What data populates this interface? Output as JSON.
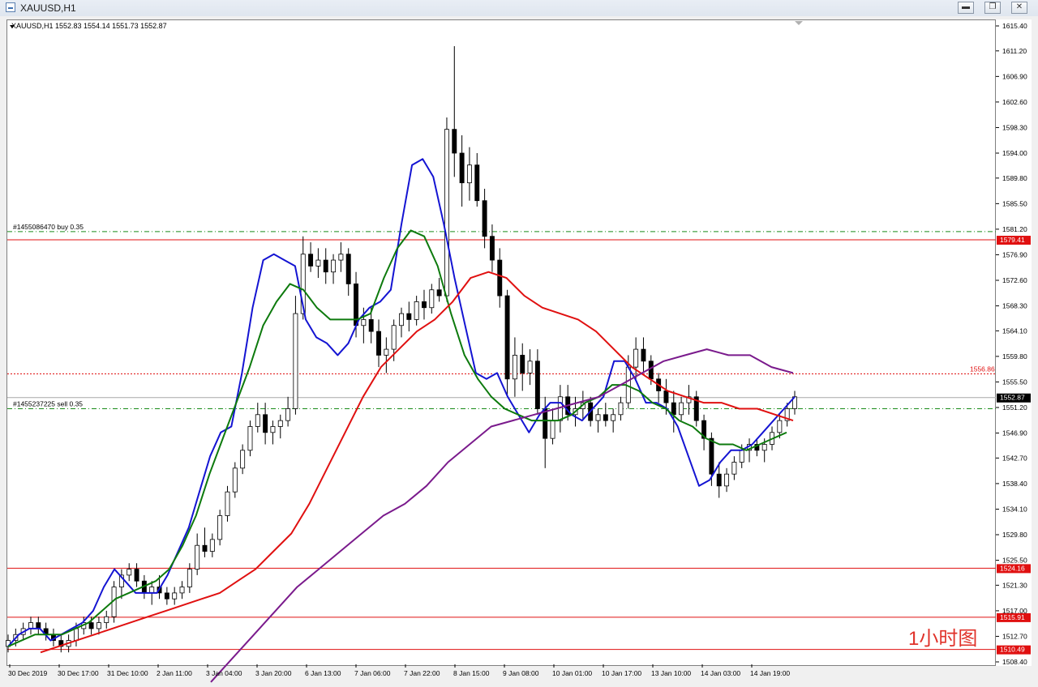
{
  "window": {
    "title": "XAUUSD,H1",
    "minimize_icon": "minimize-icon",
    "restore_icon": "restore-icon",
    "close_icon": "close-icon"
  },
  "header": {
    "symbol_info": "XAUUSD,H1  1552.83 1554.14 1551.73 1552.87",
    "dropdown_icon": "triangle-down-icon"
  },
  "annotation": {
    "text": "1小时图",
    "color": "#e0322a"
  },
  "colors": {
    "candle": "#000000",
    "ma_fast": "#1414d2",
    "ma_mid": "#0d7a0d",
    "ma_slow": "#e01010",
    "ma_long": "#7a1a8c",
    "level_line": "#e01010",
    "order_line": "#1a8c1a"
  },
  "chart_data": {
    "type": "line",
    "title": "",
    "xlabel": "",
    "ylabel": "",
    "ylim": [
      1508.4,
      1615.4
    ],
    "x_ticks": [
      "30 Dec 2019",
      "30 Dec 17:00",
      "31 Dec 10:00",
      "2 Jan 11:00",
      "3 Jan 04:00",
      "3 Jan 20:00",
      "6 Jan 13:00",
      "7 Jan 06:00",
      "7 Jan 22:00",
      "8 Jan 15:00",
      "9 Jan 08:00",
      "10 Jan 01:00",
      "10 Jan 17:00",
      "13 Jan 10:00",
      "14 Jan 03:00",
      "14 Jan 19:00"
    ],
    "y_ticks": [
      "1615.40",
      "1611.20",
      "1606.90",
      "1602.60",
      "1598.30",
      "1594.00",
      "1589.80",
      "1585.50",
      "1581.20",
      "1576.90",
      "1572.60",
      "1568.30",
      "1564.10",
      "1559.80",
      "1555.50",
      "1551.20",
      "1546.90",
      "1542.70",
      "1538.40",
      "1534.10",
      "1529.80",
      "1525.50",
      "1521.30",
      "1517.00",
      "1512.70",
      "1508.40"
    ],
    "last_price": "1552.87",
    "price_tags": [
      {
        "value": 1579.41,
        "label": "1579.41"
      },
      {
        "value": 1524.16,
        "label": "1524.16"
      },
      {
        "value": 1515.91,
        "label": "1515.91"
      },
      {
        "value": 1510.49,
        "label": "1510.49"
      }
    ],
    "alert_level": {
      "value": 1556.86,
      "label": "1556.86"
    },
    "orders": [
      {
        "label": "#1455086470 buy 0.35",
        "value": 1580.8
      },
      {
        "label": "#1455237225 sell 0.35",
        "value": 1551.0
      }
    ],
    "candles": [
      [
        1511,
        1513,
        1510,
        1512
      ],
      [
        1512,
        1514,
        1511,
        1513
      ],
      [
        1513,
        1515,
        1512,
        1514
      ],
      [
        1514,
        1516,
        1513,
        1515
      ],
      [
        1515,
        1516,
        1513,
        1514
      ],
      [
        1514,
        1515,
        1512,
        1513
      ],
      [
        1513,
        1514,
        1511,
        1512
      ],
      [
        1512,
        1513,
        1510,
        1511
      ],
      [
        1511,
        1513,
        1510,
        1512
      ],
      [
        1512,
        1515,
        1511,
        1514
      ],
      [
        1514,
        1516,
        1513,
        1515
      ],
      [
        1515,
        1516,
        1513,
        1514
      ],
      [
        1514,
        1516,
        1513,
        1515
      ],
      [
        1515,
        1517,
        1514,
        1516
      ],
      [
        1516,
        1522,
        1515,
        1521
      ],
      [
        1521,
        1524,
        1519,
        1523
      ],
      [
        1523,
        1525,
        1522,
        1524
      ],
      [
        1524,
        1525,
        1521,
        1522
      ],
      [
        1522,
        1523,
        1519,
        1520
      ],
      [
        1520,
        1522,
        1518,
        1521
      ],
      [
        1521,
        1523,
        1519,
        1520
      ],
      [
        1520,
        1521,
        1518,
        1519
      ],
      [
        1519,
        1521,
        1518,
        1520
      ],
      [
        1520,
        1522,
        1519,
        1521
      ],
      [
        1521,
        1525,
        1520,
        1524
      ],
      [
        1524,
        1530,
        1523,
        1528
      ],
      [
        1528,
        1531,
        1526,
        1527
      ],
      [
        1527,
        1530,
        1526,
        1529
      ],
      [
        1529,
        1534,
        1528,
        1533
      ],
      [
        1533,
        1538,
        1532,
        1537
      ],
      [
        1537,
        1542,
        1536,
        1541
      ],
      [
        1541,
        1545,
        1540,
        1544
      ],
      [
        1544,
        1549,
        1543,
        1548
      ],
      [
        1548,
        1552,
        1547,
        1550
      ],
      [
        1550,
        1552,
        1545,
        1547
      ],
      [
        1547,
        1549,
        1545,
        1548
      ],
      [
        1548,
        1550,
        1546,
        1549
      ],
      [
        1549,
        1553,
        1548,
        1551
      ],
      [
        1551,
        1570,
        1550,
        1567
      ],
      [
        1567,
        1580,
        1566,
        1577
      ],
      [
        1577,
        1579,
        1574,
        1575
      ],
      [
        1575,
        1578,
        1573,
        1576
      ],
      [
        1576,
        1578,
        1572,
        1574
      ],
      [
        1574,
        1577,
        1572,
        1576
      ],
      [
        1576,
        1579,
        1574,
        1577
      ],
      [
        1577,
        1578,
        1570,
        1572
      ],
      [
        1572,
        1574,
        1563,
        1565
      ],
      [
        1565,
        1568,
        1562,
        1566
      ],
      [
        1566,
        1568,
        1562,
        1564
      ],
      [
        1564,
        1566,
        1558,
        1560
      ],
      [
        1560,
        1563,
        1557,
        1561
      ],
      [
        1561,
        1566,
        1559,
        1565
      ],
      [
        1565,
        1568,
        1563,
        1567
      ],
      [
        1567,
        1569,
        1564,
        1566
      ],
      [
        1566,
        1570,
        1565,
        1569
      ],
      [
        1569,
        1571,
        1566,
        1568
      ],
      [
        1568,
        1572,
        1567,
        1571
      ],
      [
        1571,
        1573,
        1569,
        1570
      ],
      [
        1570,
        1600,
        1569,
        1598
      ],
      [
        1598,
        1612,
        1590,
        1594
      ],
      [
        1594,
        1597,
        1585,
        1589
      ],
      [
        1589,
        1595,
        1586,
        1592
      ],
      [
        1592,
        1594,
        1585,
        1586
      ],
      [
        1586,
        1588,
        1578,
        1580
      ],
      [
        1580,
        1582,
        1574,
        1576
      ],
      [
        1576,
        1578,
        1568,
        1570
      ],
      [
        1570,
        1571,
        1553,
        1556
      ],
      [
        1556,
        1563,
        1553,
        1560
      ],
      [
        1560,
        1562,
        1554,
        1557
      ],
      [
        1557,
        1561,
        1555,
        1559
      ],
      [
        1559,
        1561,
        1550,
        1551
      ],
      [
        1551,
        1553,
        1541,
        1546
      ],
      [
        1546,
        1551,
        1545,
        1549
      ],
      [
        1549,
        1555,
        1547,
        1553
      ],
      [
        1553,
        1555,
        1549,
        1550
      ],
      [
        1550,
        1553,
        1548,
        1551
      ],
      [
        1551,
        1554,
        1549,
        1552
      ],
      [
        1552,
        1553,
        1548,
        1549
      ],
      [
        1549,
        1551,
        1547,
        1550
      ],
      [
        1550,
        1552,
        1548,
        1549
      ],
      [
        1549,
        1551,
        1547,
        1550
      ],
      [
        1550,
        1553,
        1549,
        1552
      ],
      [
        1552,
        1560,
        1551,
        1558
      ],
      [
        1558,
        1563,
        1556,
        1561
      ],
      [
        1561,
        1563,
        1557,
        1559
      ],
      [
        1559,
        1560,
        1555,
        1556
      ],
      [
        1556,
        1557,
        1552,
        1554
      ],
      [
        1554,
        1556,
        1550,
        1552
      ],
      [
        1552,
        1554,
        1547,
        1550
      ],
      [
        1550,
        1553,
        1549,
        1552
      ],
      [
        1552,
        1555,
        1550,
        1553
      ],
      [
        1553,
        1554,
        1548,
        1549
      ],
      [
        1549,
        1550,
        1544,
        1546
      ],
      [
        1546,
        1547,
        1538,
        1540
      ],
      [
        1540,
        1542,
        1536,
        1538
      ],
      [
        1538,
        1541,
        1537,
        1540
      ],
      [
        1540,
        1543,
        1539,
        1542
      ],
      [
        1542,
        1545,
        1541,
        1544
      ],
      [
        1544,
        1546,
        1542,
        1545
      ],
      [
        1545,
        1546,
        1543,
        1544
      ],
      [
        1544,
        1546,
        1542,
        1545
      ],
      [
        1545,
        1548,
        1544,
        1547
      ],
      [
        1547,
        1550,
        1546,
        1549
      ],
      [
        1549,
        1552,
        1548,
        1551
      ],
      [
        1551,
        1554,
        1550,
        1553
      ]
    ],
    "series": [
      {
        "name": "",
        "color": "#1414d2",
        "y": [
          1511,
          1513,
          1514,
          1514,
          1512,
          1513,
          1514,
          1515,
          1517,
          1521,
          1524,
          1522,
          1520,
          1520,
          1520,
          1523,
          1527,
          1531,
          1537,
          1543,
          1547,
          1548,
          1557,
          1568,
          1576,
          1577,
          1576,
          1575,
          1566,
          1563,
          1562,
          1560,
          1562,
          1566,
          1568,
          1569,
          1571,
          1582,
          1592,
          1593,
          1590,
          1582,
          1573,
          1565,
          1557,
          1556,
          1557,
          1553,
          1550,
          1547,
          1550,
          1552,
          1552,
          1550,
          1549,
          1551,
          1553,
          1559,
          1559,
          1556,
          1552,
          1552,
          1551,
          1548,
          1543,
          1538,
          1539,
          1542,
          1544,
          1544,
          1545,
          1547,
          1549,
          1551,
          1553
        ]
      },
      {
        "name": "",
        "color": "#0d7a0d",
        "y": [
          1511,
          1512,
          1513,
          1513,
          1513,
          1514,
          1515,
          1517,
          1519,
          1520,
          1521,
          1522,
          1524,
          1528,
          1533,
          1540,
          1546,
          1552,
          1558,
          1565,
          1569,
          1572,
          1571,
          1568,
          1566,
          1566,
          1566,
          1567,
          1573,
          1578,
          1581,
          1580,
          1575,
          1567,
          1560,
          1556,
          1553,
          1551,
          1550,
          1549,
          1549,
          1549,
          1550,
          1552,
          1553,
          1555,
          1555,
          1554,
          1552,
          1551,
          1549,
          1548,
          1546,
          1545,
          1545,
          1544,
          1545,
          1546,
          1547
        ]
      },
      {
        "name": "",
        "color": "#e01010",
        "y": [
          1510,
          1511,
          1512,
          1513,
          1514,
          1515,
          1516,
          1517,
          1518,
          1519,
          1520,
          1522,
          1524,
          1527,
          1530,
          1535,
          1541,
          1547,
          1553,
          1558,
          1561,
          1564,
          1566,
          1569,
          1573,
          1574,
          1573,
          1570,
          1568,
          1567,
          1566,
          1564,
          1561,
          1558,
          1556,
          1554,
          1553,
          1552,
          1552,
          1551,
          1551,
          1550,
          1549
        ]
      },
      {
        "name": "",
        "color": "#7a1a8c",
        "y": [
          1505,
          1509,
          1513,
          1517,
          1521,
          1524,
          1527,
          1530,
          1533,
          1535,
          1538,
          1542,
          1545,
          1548,
          1549,
          1550,
          1551,
          1552,
          1553,
          1555,
          1557,
          1559,
          1560,
          1561,
          1560,
          1560,
          1558,
          1557
        ]
      }
    ]
  }
}
